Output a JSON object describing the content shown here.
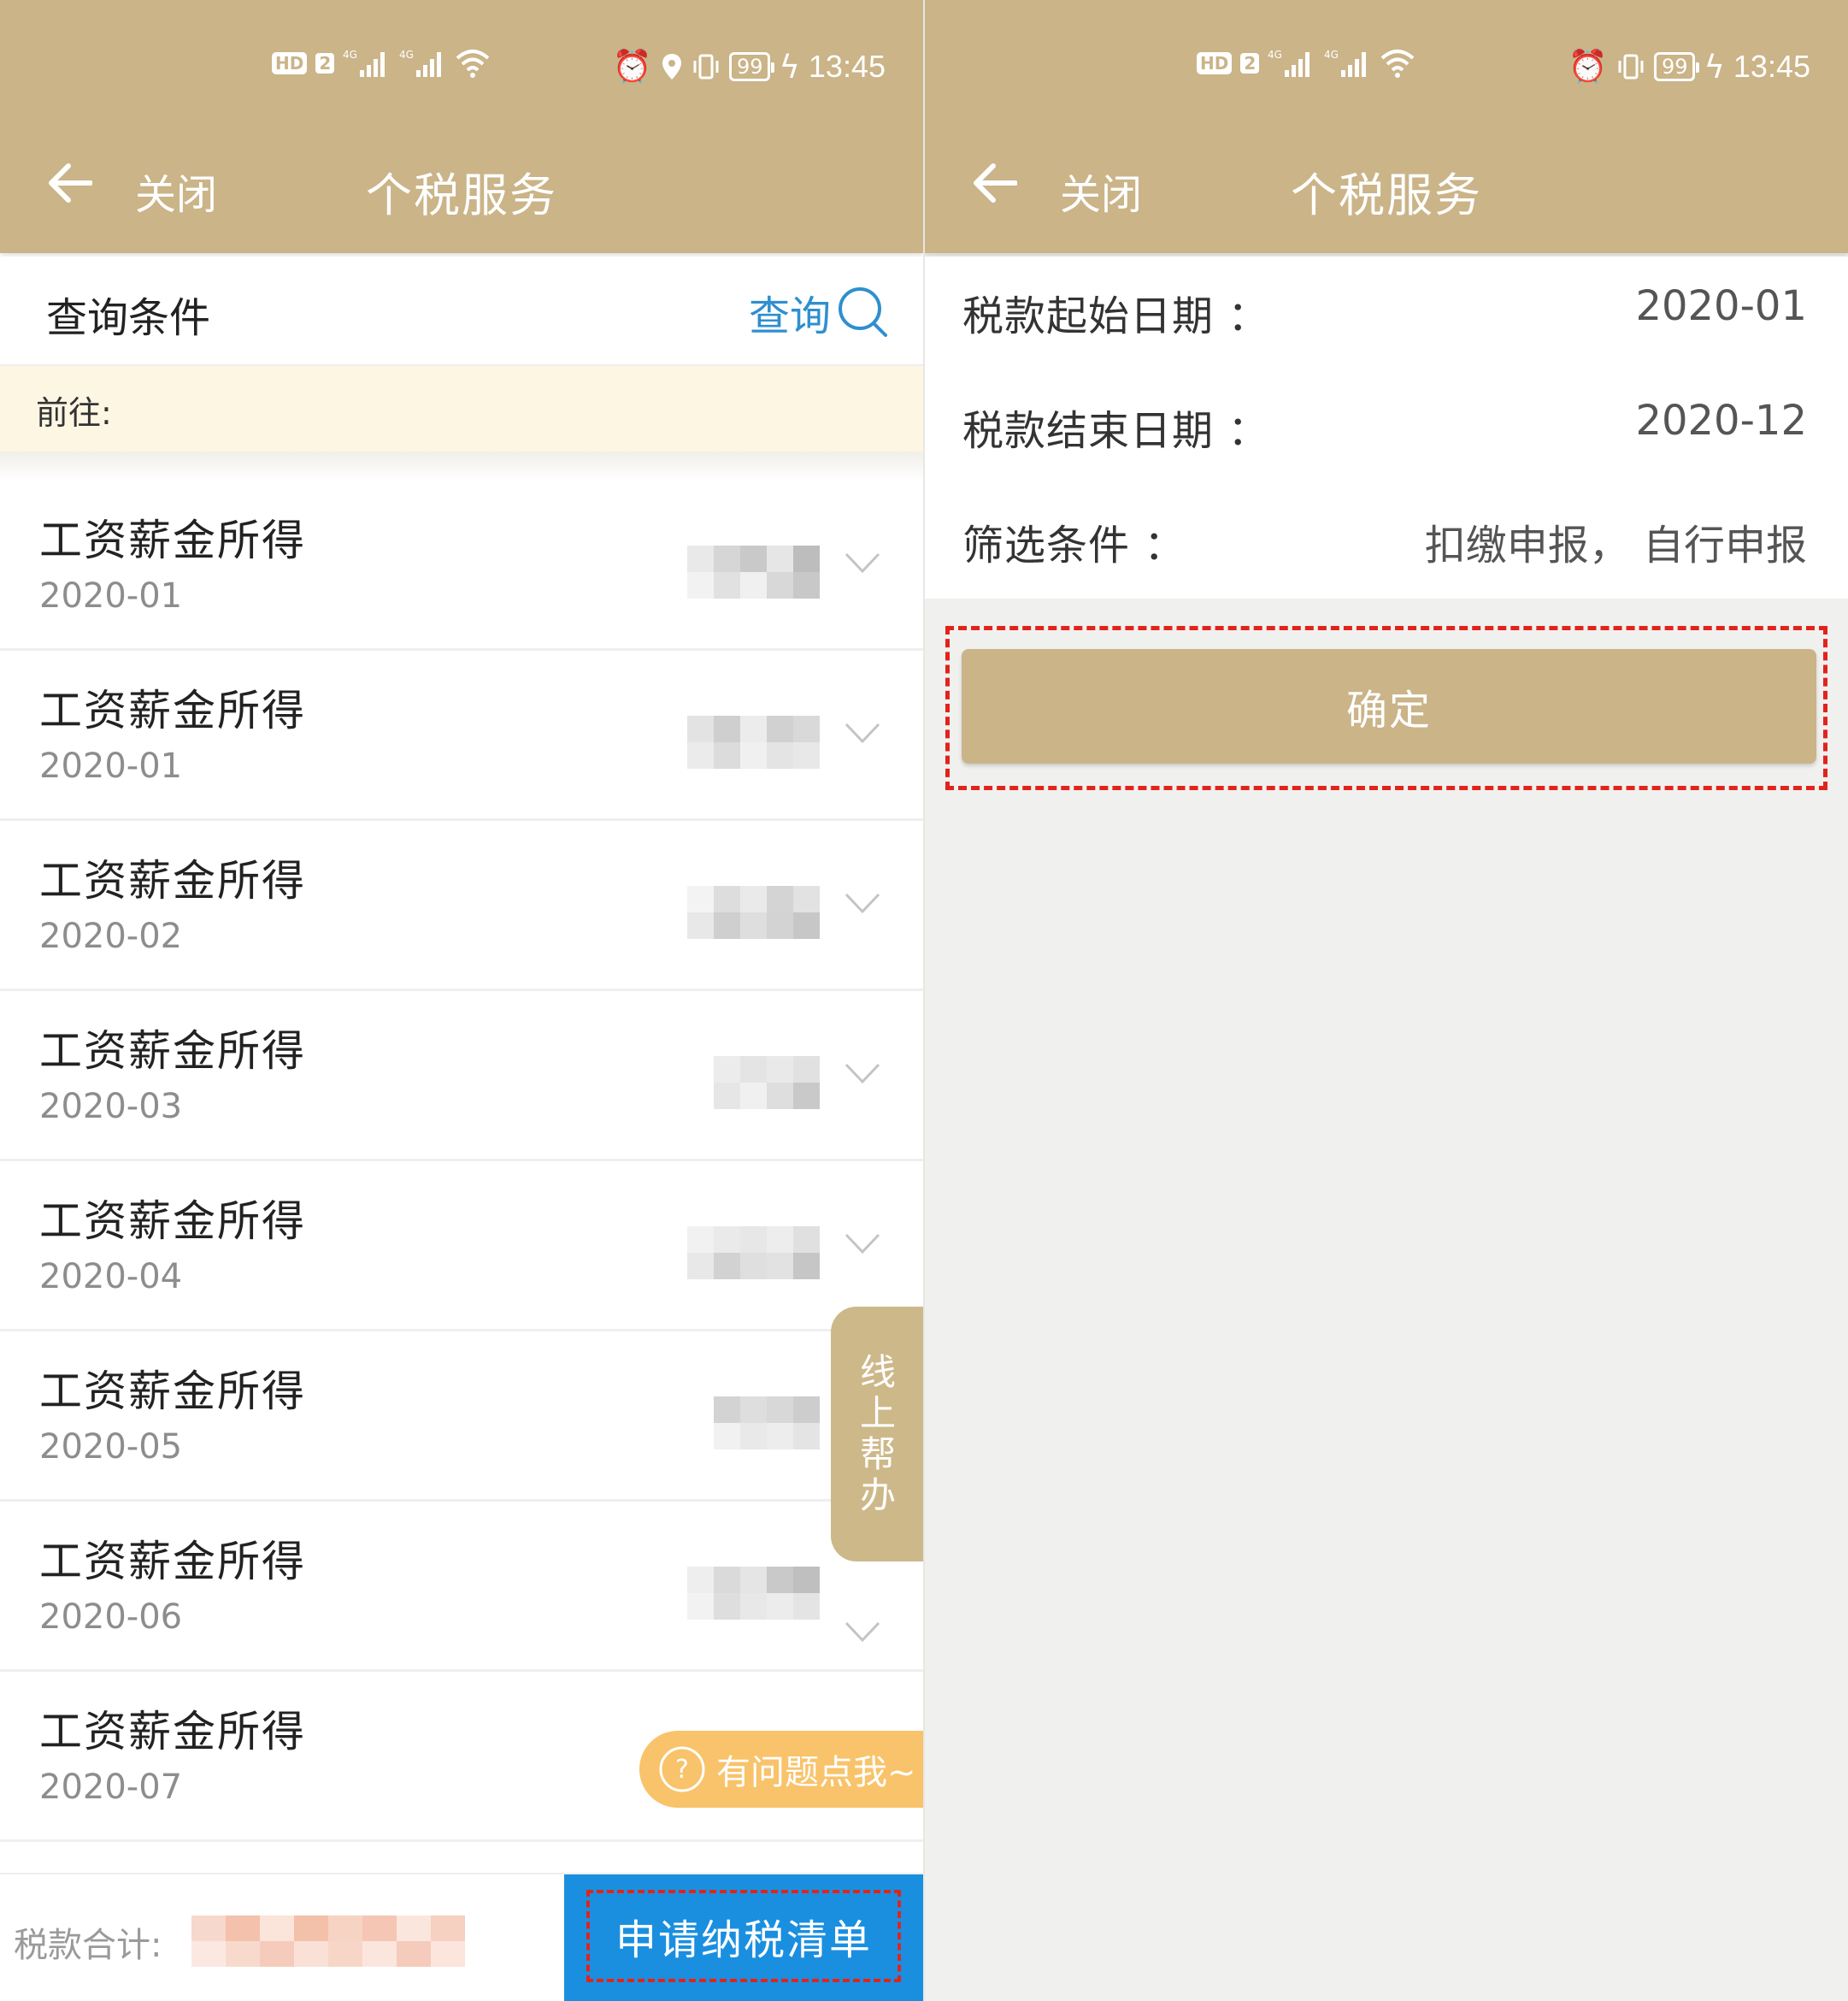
{
  "colors": {
    "header": "#cab488",
    "accent_blue": "#2f8fcf",
    "apply_button": "#1a8fe0",
    "annotation_red": "#e0241c",
    "ask_pill": "#f8c36a"
  },
  "status_bar": {
    "hd": "HD",
    "sim": "2",
    "net1": "4G",
    "net2": "4G",
    "battery": "99",
    "time": "13:45"
  },
  "left": {
    "header": {
      "back_icon": "arrow-left-icon",
      "close_label": "关闭",
      "title": "个税服务"
    },
    "query": {
      "title": "查询条件",
      "button_label": "查询",
      "icon": "search-icon"
    },
    "goto_label": "前往:",
    "rows": [
      {
        "title": "工资薪金所得",
        "date": "2020-01"
      },
      {
        "title": "工资薪金所得",
        "date": "2020-01"
      },
      {
        "title": "工资薪金所得",
        "date": "2020-02"
      },
      {
        "title": "工资薪金所得",
        "date": "2020-03"
      },
      {
        "title": "工资薪金所得",
        "date": "2020-04"
      },
      {
        "title": "工资薪金所得",
        "date": "2020-05"
      },
      {
        "title": "工资薪金所得",
        "date": "2020-06"
      },
      {
        "title": "工资薪金所得",
        "date": "2020-07"
      }
    ],
    "help_tab": [
      "线",
      "上",
      "帮",
      "办"
    ],
    "ask_label": "有问题点我~",
    "total_label": "税款合计:",
    "apply_label": "申请纳税清单"
  },
  "right": {
    "header": {
      "back_icon": "arrow-left-icon",
      "close_label": "关闭",
      "title": "个税服务"
    },
    "form": [
      {
        "label": "税款起始日期 ：",
        "value": "2020-01"
      },
      {
        "label": "税款结束日期 ：",
        "value": "2020-12"
      },
      {
        "label": "筛选条件 ：",
        "value": "扣缴申报， 自行申报"
      }
    ],
    "confirm_label": "确定"
  }
}
